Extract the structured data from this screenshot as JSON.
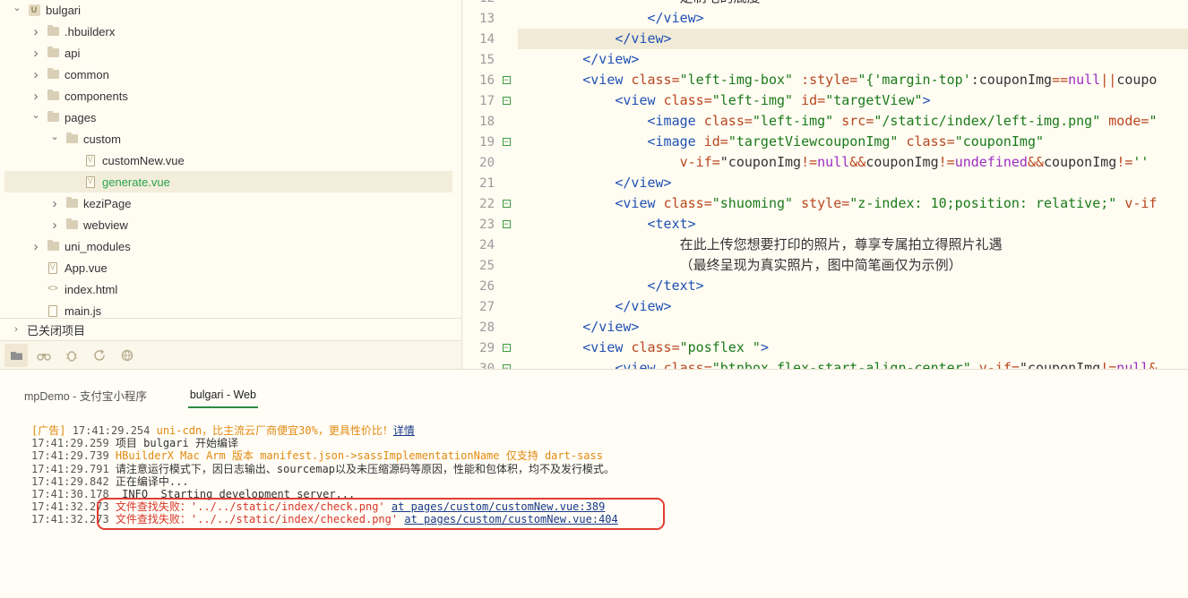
{
  "sidebar": {
    "tree": [
      {
        "label": "bulgari",
        "icon": "project-icon",
        "expanded": true,
        "depth": 0
      },
      {
        "label": ".hbuilderx",
        "icon": "folder-icon",
        "expanded": false,
        "depth": 1
      },
      {
        "label": "api",
        "icon": "folder-icon",
        "expanded": false,
        "depth": 1
      },
      {
        "label": "common",
        "icon": "folder-icon",
        "expanded": false,
        "depth": 1
      },
      {
        "label": "components",
        "icon": "folder-icon",
        "expanded": false,
        "depth": 1
      },
      {
        "label": "pages",
        "icon": "folder-icon",
        "expanded": true,
        "depth": 1
      },
      {
        "label": "custom",
        "icon": "folder-icon",
        "expanded": true,
        "depth": 2
      },
      {
        "label": "customNew.vue",
        "icon": "vue-file-icon",
        "depth": 3
      },
      {
        "label": "generate.vue",
        "icon": "vue-file-icon",
        "depth": 3,
        "selected": true
      },
      {
        "label": "keziPage",
        "icon": "folder-icon",
        "expanded": false,
        "depth": 2
      },
      {
        "label": "webview",
        "icon": "folder-icon",
        "expanded": false,
        "depth": 2
      },
      {
        "label": "uni_modules",
        "icon": "folder-icon",
        "expanded": false,
        "depth": 1
      },
      {
        "label": "App.vue",
        "icon": "vue-file-icon",
        "depth": 1
      },
      {
        "label": "index.html",
        "icon": "html-file-icon",
        "depth": 1
      },
      {
        "label": "main.js",
        "icon": "js-file-icon",
        "depth": 1
      }
    ],
    "closed_projects_label": "已关闭项目",
    "toolbar_icons": [
      "folder-icon",
      "binoculars-icon",
      "bug-icon",
      "refresh-icon",
      "globe-icon"
    ]
  },
  "editor": {
    "lines": [
      {
        "num": "12",
        "fold": false,
        "tokens": [
          [
            "plain",
            "                    "
          ],
          [
            "plain",
            "定制宅的底度"
          ]
        ]
      },
      {
        "num": "13",
        "fold": false,
        "tokens": [
          [
            "plain",
            "                "
          ],
          [
            "tag",
            "</view>"
          ]
        ]
      },
      {
        "num": "14",
        "fold": false,
        "highlight": true,
        "tokens": [
          [
            "plain",
            "            "
          ],
          [
            "tag",
            "</view>"
          ]
        ]
      },
      {
        "num": "15",
        "fold": false,
        "tokens": [
          [
            "plain",
            "        "
          ],
          [
            "tag",
            "</view>"
          ]
        ]
      },
      {
        "num": "16",
        "fold": true,
        "tokens": [
          [
            "plain",
            "        "
          ],
          [
            "tag",
            "<view "
          ],
          [
            "attr",
            "class"
          ],
          [
            "op",
            "="
          ],
          [
            "str",
            "\"left-img-box\""
          ],
          [
            "plain",
            " "
          ],
          [
            "attr",
            ":style"
          ],
          [
            "op",
            "="
          ],
          [
            "str",
            "\"{'margin-top'"
          ],
          [
            "plain",
            ":couponImg"
          ],
          [
            "op",
            "=="
          ],
          [
            "kw",
            "null"
          ],
          [
            "op",
            "||"
          ],
          [
            "plain",
            "coupo"
          ]
        ]
      },
      {
        "num": "17",
        "fold": true,
        "tokens": [
          [
            "plain",
            "            "
          ],
          [
            "tag",
            "<view "
          ],
          [
            "attr",
            "class"
          ],
          [
            "op",
            "="
          ],
          [
            "str",
            "\"left-img\""
          ],
          [
            "plain",
            " "
          ],
          [
            "attr",
            "id"
          ],
          [
            "op",
            "="
          ],
          [
            "str",
            "\"targetView\""
          ],
          [
            "tag",
            ">"
          ]
        ]
      },
      {
        "num": "18",
        "fold": false,
        "tokens": [
          [
            "plain",
            "                "
          ],
          [
            "tag",
            "<image "
          ],
          [
            "attr",
            "class"
          ],
          [
            "op",
            "="
          ],
          [
            "str",
            "\"left-img\""
          ],
          [
            "plain",
            " "
          ],
          [
            "attr",
            "src"
          ],
          [
            "op",
            "="
          ],
          [
            "str",
            "\"/static/index/left-img.png\""
          ],
          [
            "plain",
            " "
          ],
          [
            "attr",
            "mode"
          ],
          [
            "op",
            "="
          ],
          [
            "str",
            "\""
          ]
        ]
      },
      {
        "num": "19",
        "fold": true,
        "tokens": [
          [
            "plain",
            "                "
          ],
          [
            "tag",
            "<image "
          ],
          [
            "attr",
            "id"
          ],
          [
            "op",
            "="
          ],
          [
            "str",
            "\"targetViewcouponImg\""
          ],
          [
            "plain",
            " "
          ],
          [
            "attr",
            "class"
          ],
          [
            "op",
            "="
          ],
          [
            "str",
            "\"couponImg\""
          ]
        ]
      },
      {
        "num": "20",
        "fold": false,
        "tokens": [
          [
            "plain",
            "                    "
          ],
          [
            "attr",
            "v-if"
          ],
          [
            "op",
            "="
          ],
          [
            "plain",
            "\"couponImg"
          ],
          [
            "op",
            "!="
          ],
          [
            "kw",
            "null"
          ],
          [
            "op",
            "&&"
          ],
          [
            "plain",
            "couponImg"
          ],
          [
            "op",
            "!="
          ],
          [
            "kw",
            "undefined"
          ],
          [
            "op",
            "&&"
          ],
          [
            "plain",
            "couponImg"
          ],
          [
            "op",
            "!="
          ],
          [
            "str",
            "''"
          ]
        ]
      },
      {
        "num": "21",
        "fold": false,
        "tokens": [
          [
            "plain",
            "            "
          ],
          [
            "tag",
            "</view>"
          ]
        ]
      },
      {
        "num": "22",
        "fold": true,
        "tokens": [
          [
            "plain",
            "            "
          ],
          [
            "tag",
            "<view "
          ],
          [
            "attr",
            "class"
          ],
          [
            "op",
            "="
          ],
          [
            "str",
            "\"shuoming\""
          ],
          [
            "plain",
            " "
          ],
          [
            "attr",
            "style"
          ],
          [
            "op",
            "="
          ],
          [
            "str",
            "\"z-index: 10;position: relative;\""
          ],
          [
            "plain",
            " "
          ],
          [
            "attr",
            "v-if"
          ]
        ]
      },
      {
        "num": "23",
        "fold": true,
        "tokens": [
          [
            "plain",
            "                "
          ],
          [
            "tag",
            "<text>"
          ]
        ]
      },
      {
        "num": "24",
        "fold": false,
        "tokens": [
          [
            "plain",
            "                    在此上传您想要打印的照片，尊享专属拍立得照片礼遇"
          ]
        ]
      },
      {
        "num": "25",
        "fold": false,
        "tokens": [
          [
            "plain",
            "                    （最终呈现为真实照片，图中简笔画仅为示例）"
          ]
        ]
      },
      {
        "num": "26",
        "fold": false,
        "tokens": [
          [
            "plain",
            "                "
          ],
          [
            "tag",
            "</text>"
          ]
        ]
      },
      {
        "num": "27",
        "fold": false,
        "tokens": [
          [
            "plain",
            "            "
          ],
          [
            "tag",
            "</view>"
          ]
        ]
      },
      {
        "num": "28",
        "fold": false,
        "tokens": [
          [
            "plain",
            "        "
          ],
          [
            "tag",
            "</view>"
          ]
        ]
      },
      {
        "num": "29",
        "fold": true,
        "tokens": [
          [
            "plain",
            "        "
          ],
          [
            "tag",
            "<view "
          ],
          [
            "attr",
            "class"
          ],
          [
            "op",
            "="
          ],
          [
            "str",
            "\"posflex \""
          ],
          [
            "tag",
            ">"
          ]
        ]
      },
      {
        "num": "30",
        "fold": true,
        "tokens": [
          [
            "plain",
            "            "
          ],
          [
            "tag",
            "<view "
          ],
          [
            "attr",
            "class"
          ],
          [
            "op",
            "="
          ],
          [
            "str",
            "\"btnbox flex-start-align-center\""
          ],
          [
            "plain",
            " "
          ],
          [
            "attr",
            "v-if"
          ],
          [
            "op",
            "="
          ],
          [
            "plain",
            "\"couponImg"
          ],
          [
            "op",
            "!="
          ],
          [
            "kw",
            "null"
          ],
          [
            "op",
            "&"
          ]
        ]
      }
    ]
  },
  "console": {
    "tabs": [
      {
        "label": "mpDemo - 支付宝小程序",
        "active": false
      },
      {
        "label": "bulgari - Web",
        "active": true
      }
    ],
    "log": [
      [
        [
          "orange",
          "[广告] "
        ],
        [
          "ts",
          "17:41:29.254 "
        ],
        [
          "orange",
          "uni-cdn，比主流云厂商便宜30%，更具性价比！"
        ],
        [
          "link",
          "详情"
        ]
      ],
      [
        [
          "ts",
          "17:41:29.259 "
        ],
        [
          "plain",
          "项目 bulgari 开始编译"
        ]
      ],
      [
        [
          "ts",
          "17:41:29.739 "
        ],
        [
          "orange",
          "HBuilderX Mac Arm 版本 manifest.json->sassImplementationName 仅支持 dart-sass"
        ]
      ],
      [
        [
          "ts",
          "17:41:29.791 "
        ],
        [
          "plain",
          "请注意运行模式下，因日志输出、sourcemap以及未压缩源码等原因，性能和包体积，均不及发行模式。"
        ]
      ],
      [
        [
          "ts",
          "17:41:29.842 "
        ],
        [
          "plain",
          "正在编译中..."
        ]
      ],
      [
        [
          "ts",
          "17:41:30.178 "
        ],
        [
          "plain",
          " INFO  Starting development server..."
        ]
      ],
      [
        [
          "ts",
          "17:41:32.273 "
        ],
        [
          "red",
          "文件查找失败：'../../static/index/check.png' "
        ],
        [
          "link",
          "at pages/custom/customNew.vue:389"
        ]
      ],
      [
        [
          "ts",
          "17:41:32.273 "
        ],
        [
          "red",
          "文件查找失败：'../../static/index/checked.png' "
        ],
        [
          "link",
          "at pages/custom/customNew.vue:404"
        ]
      ]
    ]
  },
  "colors": {
    "background": "#fffcf2",
    "selected_file": "#27a54a",
    "error_outline": "#e03d33",
    "warning": "#e28a11",
    "error": "#d8372a"
  }
}
